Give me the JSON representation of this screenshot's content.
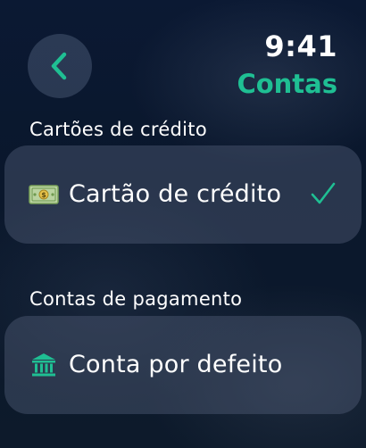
{
  "status": {
    "time": "9:41"
  },
  "nav": {
    "title": "Contas",
    "back_icon": "chevron-left-icon",
    "accent_color": "#1fbf93"
  },
  "sections": [
    {
      "header": "Cartões de crédito",
      "items": [
        {
          "label": "Cartão de crédito",
          "icon": "money-bill-icon",
          "selected": true
        }
      ]
    },
    {
      "header": "Contas de pagamento",
      "items": [
        {
          "label": "Conta por defeito",
          "icon": "bank-icon",
          "selected": false
        }
      ]
    }
  ]
}
